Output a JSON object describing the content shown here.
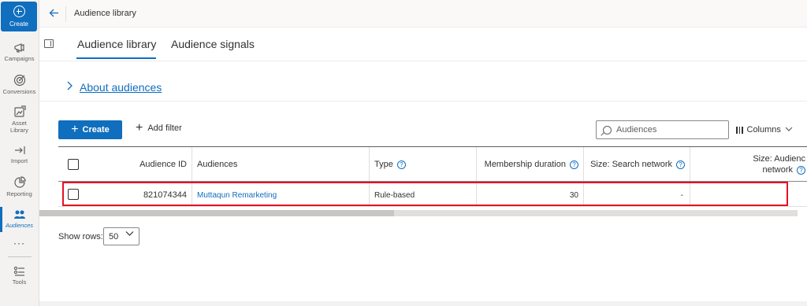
{
  "nav": {
    "create_label": "Create",
    "items": [
      {
        "icon": "megaphone-icon",
        "label": "Campaigns"
      },
      {
        "icon": "target-icon",
        "label": "Conversions"
      },
      {
        "icon": "asset-library-icon",
        "label": "Asset\nLibrary"
      },
      {
        "icon": "import-icon",
        "label": "Import"
      },
      {
        "icon": "reporting-icon",
        "label": "Reporting"
      },
      {
        "icon": "audiences-icon",
        "label": "Audiences"
      },
      {
        "icon": "more-icon",
        "label": "···"
      },
      {
        "icon": "tools-icon",
        "label": "Tools"
      }
    ],
    "active": "Audiences",
    "accent": "#106ebe"
  },
  "header": {
    "title": "Audience library"
  },
  "tabs": [
    {
      "label": "Audience library",
      "active": true
    },
    {
      "label": "Audience signals",
      "active": false
    }
  ],
  "about": {
    "link_label": "About audiences"
  },
  "toolbar": {
    "create_label": "Create",
    "add_filter_label": "Add filter",
    "search_placeholder": "Audiences",
    "columns_label": "Columns"
  },
  "table": {
    "headers": {
      "audience_id": "Audience ID",
      "audiences": "Audiences",
      "type": "Type",
      "membership_duration": "Membership duration",
      "size_search": "Size: Search network",
      "size_audience_1": "Size: Audienc",
      "size_audience_2": "network"
    },
    "rows": [
      {
        "audience_id": "821074344",
        "audience_name": "Muttaqun Remarketing",
        "type": "Rule-based",
        "membership_duration": "30",
        "size_search": "-",
        "size_audience": ""
      }
    ]
  },
  "pagination": {
    "show_rows_label": "Show rows:",
    "rows_value": "50"
  }
}
